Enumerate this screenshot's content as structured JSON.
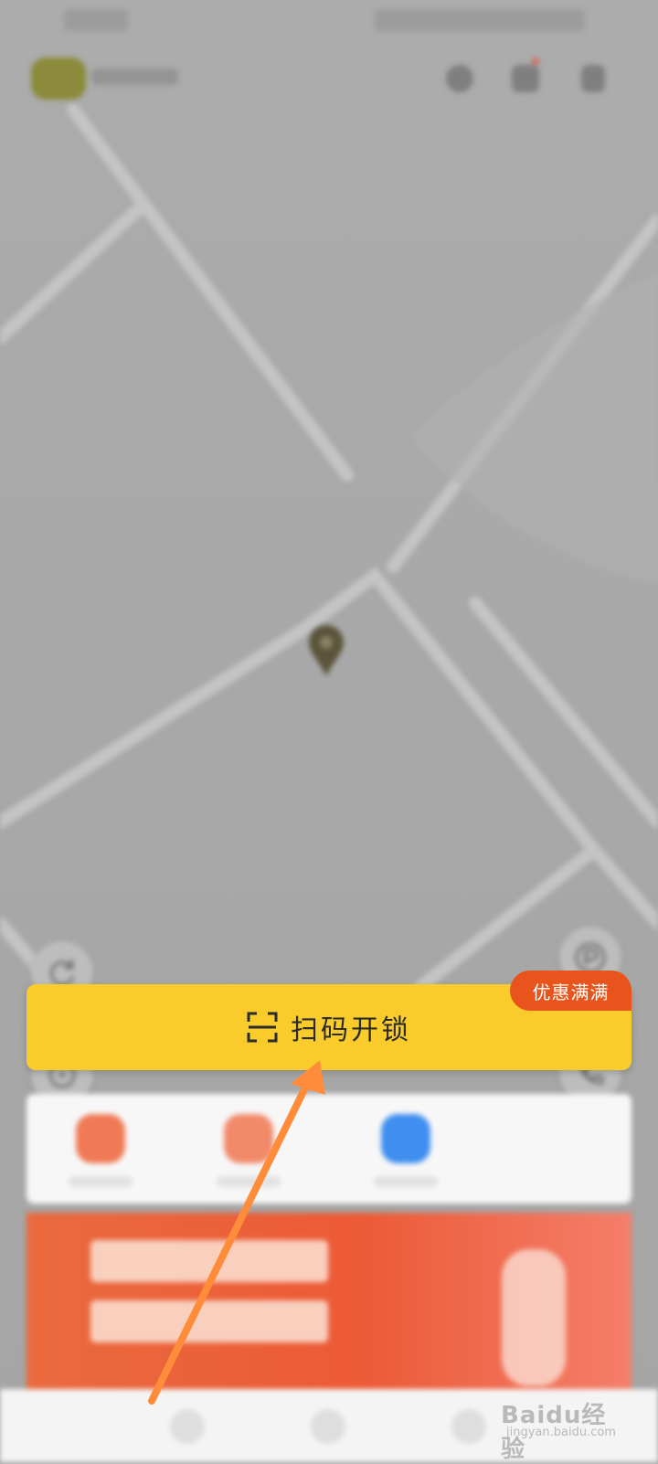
{
  "scan_unlock": {
    "label": "扫码开锁",
    "icon": "scan-frame-icon"
  },
  "promo_badge": {
    "label": "优惠满满"
  },
  "watermark": {
    "brand": "Baidu经验",
    "url": "jingyan.baidu.com"
  },
  "colors": {
    "unlock_button": "#f9cc2c",
    "promo_badge": "#e8541b",
    "arrow": "#ff8c3a",
    "map": "#a8a8a8"
  }
}
